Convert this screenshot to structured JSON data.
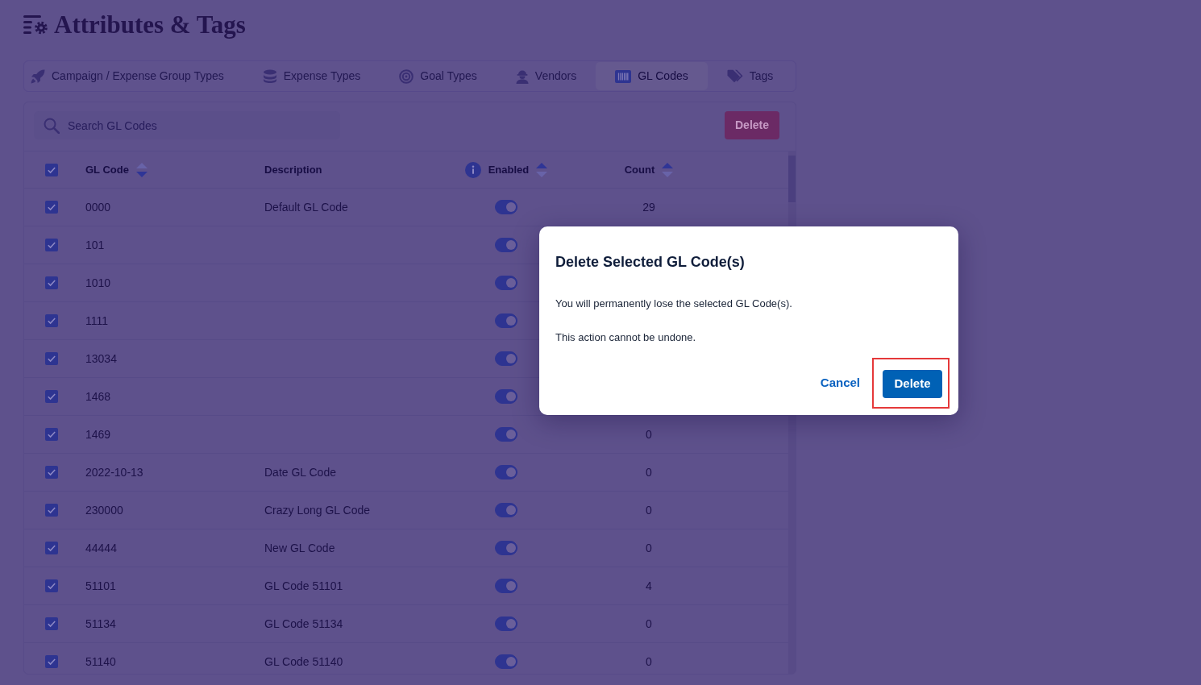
{
  "page": {
    "title": "Attributes & Tags"
  },
  "tabs": [
    {
      "label": "Campaign / Expense Group Types",
      "selected": false
    },
    {
      "label": "Expense Types",
      "selected": false
    },
    {
      "label": "Goal Types",
      "selected": false
    },
    {
      "label": "Vendors",
      "selected": false
    },
    {
      "label": "GL Codes",
      "selected": true
    },
    {
      "label": "Tags",
      "selected": false
    }
  ],
  "toolbar": {
    "search": {
      "placeholder": "Search GL Codes"
    },
    "delete_button": {
      "label": "Delete"
    }
  },
  "table": {
    "select_all": {
      "checked": true
    },
    "columns": [
      {
        "label": "GL Code",
        "sort_descending": true
      },
      {
        "label": "Description"
      },
      {
        "label": "Enabled",
        "info": true,
        "sort_descending": false
      },
      {
        "label": "Count",
        "sort_descending": false
      }
    ],
    "rows": [
      {
        "checked": true,
        "gl_code": "0000",
        "description": "Default GL Code",
        "enabled": true,
        "count": "29"
      },
      {
        "checked": true,
        "gl_code": "101",
        "enabled": true
      },
      {
        "checked": true,
        "gl_code": "1010",
        "enabled": true
      },
      {
        "checked": true,
        "gl_code": "1111",
        "enabled": true
      },
      {
        "checked": true,
        "gl_code": "13034",
        "enabled": true
      },
      {
        "checked": true,
        "gl_code": "1468",
        "enabled": true
      },
      {
        "checked": true,
        "gl_code": "1469",
        "enabled": true,
        "count": "0"
      },
      {
        "checked": true,
        "gl_code": "2022-10-13",
        "description": "Date GL Code",
        "enabled": true,
        "count": "0"
      },
      {
        "checked": true,
        "gl_code": "230000",
        "description": "Crazy Long GL Code",
        "enabled": true,
        "count": "0"
      },
      {
        "checked": true,
        "gl_code": "44444",
        "description": "New GL Code",
        "enabled": true,
        "count": "0"
      },
      {
        "checked": true,
        "gl_code": "51101",
        "description": "GL Code 51101",
        "enabled": true,
        "count": "4"
      },
      {
        "checked": true,
        "gl_code": "51134",
        "description": "GL Code 51134",
        "enabled": true,
        "count": "0"
      },
      {
        "checked": true,
        "gl_code": "51140",
        "description": "GL Code 51140",
        "enabled": true,
        "count": "0"
      }
    ]
  },
  "dialog": {
    "title": "Delete Selected GL Code(s)",
    "paragraphs": [
      "You will permanently lose the selected GL Code(s).",
      "This action cannot be undone."
    ],
    "cancel": "Cancel",
    "confirm": "Delete",
    "confirm_highlighted": true
  }
}
